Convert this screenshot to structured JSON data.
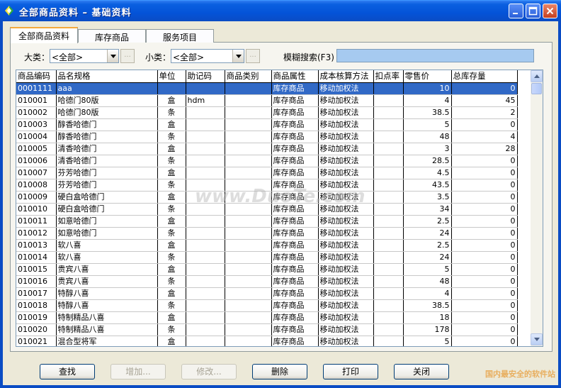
{
  "window": {
    "title": "全部商品资料 – 基础资料"
  },
  "tabs": [
    {
      "label": "全部商品资料"
    },
    {
      "label": "库存商品"
    },
    {
      "label": "服务项目"
    }
  ],
  "filters": {
    "major_label": "大类：",
    "major_value": "<全部>",
    "minor_label": "小类：",
    "minor_value": "<全部>",
    "dots": "...",
    "search_label": "模糊搜索(F3)",
    "search_value": ""
  },
  "grid": {
    "columns": [
      "商品编码",
      "品名规格",
      "单位",
      "助记码",
      "商品类别",
      "商品属性",
      "成本核算方法",
      "扣点率",
      "零售价",
      "总库存量"
    ],
    "rows": [
      [
        "0001111",
        "aaa",
        "",
        "",
        "",
        "库存商品",
        "移动加权法",
        "",
        "10",
        "0"
      ],
      [
        "010001",
        "哈德门80版",
        "盒",
        "hdm",
        "",
        "库存商品",
        "移动加权法",
        "",
        "4",
        "45"
      ],
      [
        "010002",
        "哈德门80版",
        "条",
        "",
        "",
        "库存商品",
        "移动加权法",
        "",
        "38.5",
        "2"
      ],
      [
        "010003",
        "醇香哈德门",
        "盒",
        "",
        "",
        "库存商品",
        "移动加权法",
        "",
        "5",
        "0"
      ],
      [
        "010004",
        "醇香哈德门",
        "条",
        "",
        "",
        "库存商品",
        "移动加权法",
        "",
        "48",
        "4"
      ],
      [
        "010005",
        "清香哈德门",
        "盒",
        "",
        "",
        "库存商品",
        "移动加权法",
        "",
        "3",
        "28"
      ],
      [
        "010006",
        "清香哈德门",
        "条",
        "",
        "",
        "库存商品",
        "移动加权法",
        "",
        "28.5",
        "0"
      ],
      [
        "010007",
        "芬芳哈德门",
        "盒",
        "",
        "",
        "库存商品",
        "移动加权法",
        "",
        "4.5",
        "0"
      ],
      [
        "010008",
        "芬芳哈德门",
        "条",
        "",
        "",
        "库存商品",
        "移动加权法",
        "",
        "43.5",
        "0"
      ],
      [
        "010009",
        "硬白盒哈德门",
        "盒",
        "",
        "",
        "库存商品",
        "移动加权法",
        "",
        "3.5",
        "0"
      ],
      [
        "010010",
        "硬白盒哈德门",
        "条",
        "",
        "",
        "库存商品",
        "移动加权法",
        "",
        "34",
        "0"
      ],
      [
        "010011",
        "如意哈德门",
        "盒",
        "",
        "",
        "库存商品",
        "移动加权法",
        "",
        "2.5",
        "0"
      ],
      [
        "010012",
        "如意哈德门",
        "条",
        "",
        "",
        "库存商品",
        "移动加权法",
        "",
        "24",
        "0"
      ],
      [
        "010013",
        "软八喜",
        "盒",
        "",
        "",
        "库存商品",
        "移动加权法",
        "",
        "2.5",
        "0"
      ],
      [
        "010014",
        "软八喜",
        "条",
        "",
        "",
        "库存商品",
        "移动加权法",
        "",
        "24",
        "0"
      ],
      [
        "010015",
        "贵宾八喜",
        "盒",
        "",
        "",
        "库存商品",
        "移动加权法",
        "",
        "5",
        "0"
      ],
      [
        "010016",
        "贵宾八喜",
        "条",
        "",
        "",
        "库存商品",
        "移动加权法",
        "",
        "48",
        "0"
      ],
      [
        "010017",
        "特醇八喜",
        "盒",
        "",
        "",
        "库存商品",
        "移动加权法",
        "",
        "4",
        "0"
      ],
      [
        "010018",
        "特醇八喜",
        "条",
        "",
        "",
        "库存商品",
        "移动加权法",
        "",
        "38.5",
        "0"
      ],
      [
        "010019",
        "特制精品八喜",
        "盒",
        "",
        "",
        "库存商品",
        "移动加权法",
        "",
        "18",
        "0"
      ],
      [
        "010020",
        "特制精品八喜",
        "条",
        "",
        "",
        "库存商品",
        "移动加权法",
        "",
        "178",
        "0"
      ],
      [
        "010021",
        "混合型将军",
        "盒",
        "",
        "",
        "库存商品",
        "移动加权法",
        "",
        "5",
        "0"
      ]
    ]
  },
  "buttons": {
    "find": "查找",
    "add": "增加...",
    "edit": "修改...",
    "delete": "删除",
    "print": "打印",
    "close": "关闭"
  },
  "watermark": {
    "center": "www.DuoTe.com",
    "corner": "国内最安全的软件站"
  },
  "colors": {
    "titlebar": "#0453d8",
    "selection": "#3169c6",
    "search_box": "#a6caf0"
  }
}
